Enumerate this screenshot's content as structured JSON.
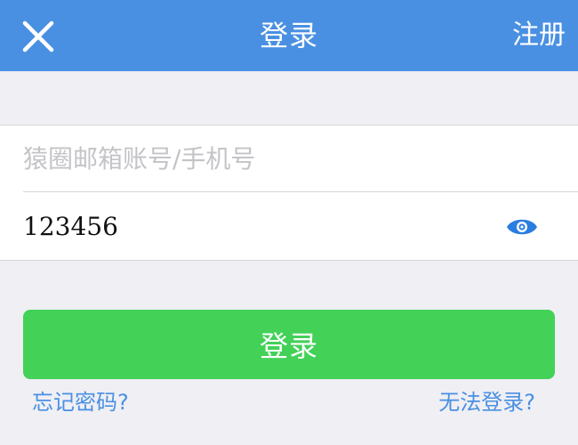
{
  "header": {
    "title": "登录",
    "register_label": "注册",
    "close_icon": "close-icon",
    "background_color": "#4a90e2"
  },
  "form": {
    "account_placeholder": "猿圈邮箱账号/手机号",
    "account_value": "",
    "password_value": "123456",
    "eye_icon": "eye-icon",
    "eye_icon_color": "#2a7de1"
  },
  "login_button": {
    "label": "登录",
    "color": "#43d158"
  },
  "links": {
    "forgot_password": "忘记密码?",
    "cannot_login": "无法登录?",
    "color": "#4a90e2"
  }
}
